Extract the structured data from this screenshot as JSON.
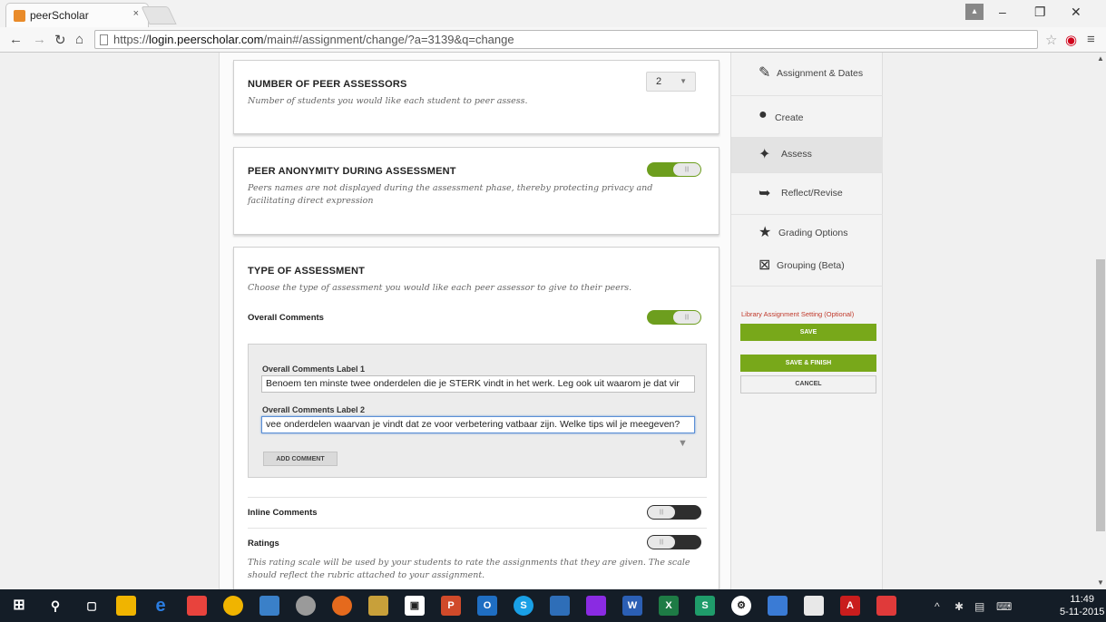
{
  "browser": {
    "tab_title": "peerScholar",
    "tab_close": "×",
    "url_scheme": "https://",
    "url_host": "login.peerscholar.com",
    "url_path": "/main#/assignment/change/?a=3139&q=change"
  },
  "cards": {
    "peer_assessors": {
      "title": "NUMBER OF PEER ASSESSORS",
      "description": "Number of students you would like each student to peer assess.",
      "select_value": "2"
    },
    "anonymity": {
      "title": "PEER ANONYMITY DURING ASSESSMENT",
      "description": "Peers names are not displayed during the assessment phase, thereby protecting privacy and facilitating direct expression",
      "toggle_state": "on"
    },
    "assessment_type": {
      "title": "TYPE OF ASSESSMENT",
      "description": "Choose the type of assessment you would like each peer assessor to give to their peers.",
      "overall_comments_label": "Overall Comments",
      "label1": "Overall Comments Label 1",
      "value1": "Benoem ten minste twee onderdelen die je STERK vindt in het werk. Leg ook uit waarom je dat vir",
      "label2": "Overall Comments Label 2",
      "value2": "vee onderdelen waarvan je vindt dat ze voor verbetering vatbaar zijn. Welke tips wil je meegeven?",
      "add_comment": "ADD COMMENT",
      "inline_comments": "Inline Comments",
      "ratings": "Ratings",
      "ratings_description": "This rating scale will be used by your students to rate the assignments that they are given. The scale should reflect the rubric attached to your assignment."
    }
  },
  "sidebar": {
    "items": [
      {
        "label": "Assignment & Dates",
        "icon": "edit-icon"
      },
      {
        "label": "Create",
        "icon": "lightbulb-icon"
      },
      {
        "label": "Assess",
        "icon": "hands-icon"
      },
      {
        "label": "Reflect/Revise",
        "icon": "reflect-icon"
      },
      {
        "label": "Grading Options",
        "icon": "star-icon"
      },
      {
        "label": "Grouping (Beta)",
        "icon": "grouping-icon"
      }
    ],
    "library_label": "Library Assignment Setting (Optional)",
    "save": "SAVE",
    "save_finish": "SAVE & FINISH",
    "cancel": "CANCEL"
  },
  "taskbar": {
    "time": "11:49",
    "date": "5-11-2015"
  },
  "colors": {
    "toggle_on": "#6d9e1e",
    "toggle_off": "#2e2e2e",
    "save_green": "#78a81a",
    "library_red": "#c0392b"
  }
}
